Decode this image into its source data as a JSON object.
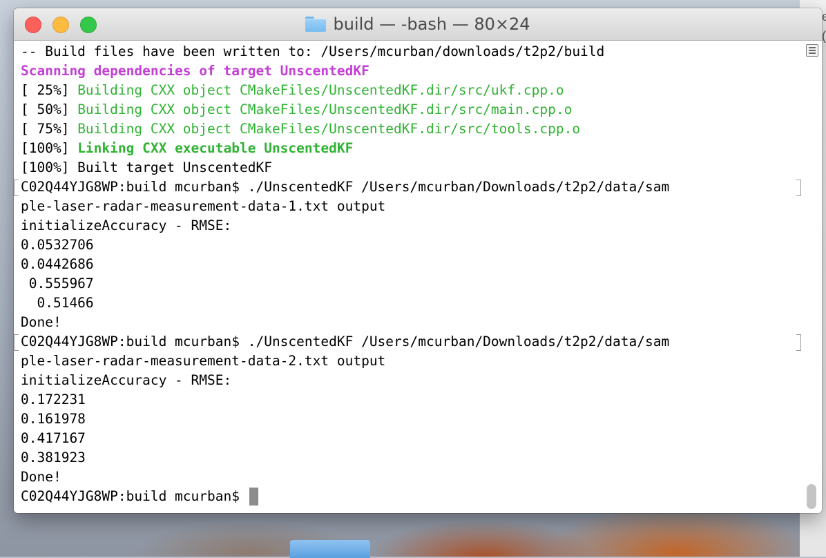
{
  "window": {
    "title": "build — -bash — 80×24"
  },
  "behind_window": {
    "edge_text": "e\n("
  },
  "terminal": {
    "lines": [
      {
        "text": "-- Build files have been written to: /Users/mcurban/downloads/t2p2/build"
      },
      {
        "text": "Scanning dependencies of target UnscentedKF",
        "style": "bold magenta"
      },
      {
        "prefix": "[ 25%] ",
        "text": "Building CXX object CMakeFiles/UnscentedKF.dir/src/ukf.cpp.o",
        "style": "green"
      },
      {
        "prefix": "[ 50%] ",
        "text": "Building CXX object CMakeFiles/UnscentedKF.dir/src/main.cpp.o",
        "style": "green"
      },
      {
        "prefix": "[ 75%] ",
        "text": "Building CXX object CMakeFiles/UnscentedKF.dir/src/tools.cpp.o",
        "style": "green"
      },
      {
        "prefix": "[100%] ",
        "text": "Linking CXX executable UnscentedKF",
        "style": "bold green"
      },
      {
        "text": "[100%] Built target UnscentedKF"
      },
      {
        "text": "C02Q44YJG8WP:build mcurban$ ./UnscentedKF /Users/mcurban/Downloads/t2p2/data/sam",
        "wrapped": true
      },
      {
        "text": "ple-laser-radar-measurement-data-1.txt output"
      },
      {
        "text": "initializeAccuracy - RMSE:"
      },
      {
        "text": "0.0532706"
      },
      {
        "text": "0.0442686"
      },
      {
        "text": " 0.555967"
      },
      {
        "text": "  0.51466"
      },
      {
        "text": "Done!"
      },
      {
        "text": "C02Q44YJG8WP:build mcurban$ ./UnscentedKF /Users/mcurban/Downloads/t2p2/data/sam",
        "wrapped": true
      },
      {
        "text": "ple-laser-radar-measurement-data-2.txt output"
      },
      {
        "text": "initializeAccuracy - RMSE:"
      },
      {
        "text": "0.172231"
      },
      {
        "text": "0.161978"
      },
      {
        "text": "0.417167"
      },
      {
        "text": "0.381923"
      },
      {
        "text": "Done!"
      }
    ],
    "prompt": "C02Q44YJG8WP:build mcurban$ "
  },
  "colors": {
    "magenta": "#c43fd5",
    "green": "#2fb332",
    "cursor": "#8c8c8c",
    "close": "#fc605b",
    "minimize": "#fdbc40",
    "zoom": "#34c84a"
  },
  "icons": {
    "title": "folder-icon",
    "gutter": "terminal-menu-icon"
  }
}
